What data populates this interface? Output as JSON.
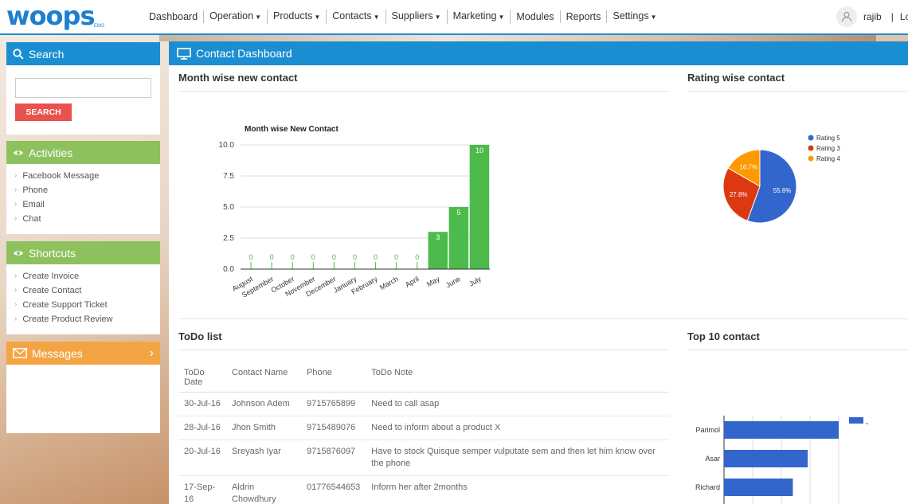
{
  "app": {
    "logo": "woops",
    "logo_sub": "EMS"
  },
  "nav": [
    {
      "label": "Dashboard",
      "caret": false
    },
    {
      "label": "Operation",
      "caret": true
    },
    {
      "label": "Products",
      "caret": true
    },
    {
      "label": "Contacts",
      "caret": true
    },
    {
      "label": "Suppliers",
      "caret": true
    },
    {
      "label": "Marketing",
      "caret": true
    },
    {
      "label": "Modules",
      "caret": false
    },
    {
      "label": "Reports",
      "caret": false
    },
    {
      "label": "Settings",
      "caret": true
    }
  ],
  "user": {
    "name": "rajib",
    "sep": "|",
    "logout": "Lo"
  },
  "sidebar": {
    "search": {
      "title": "Search",
      "placeholder": "",
      "button": "SEARCH"
    },
    "activities": {
      "title": "Activities",
      "items": [
        "Facebook Message",
        "Phone",
        "Email",
        "Chat"
      ]
    },
    "shortcuts": {
      "title": "Shortcuts",
      "items": [
        "Create Invoice",
        "Create Contact",
        "Create Support Ticket",
        "Create Product Review"
      ]
    },
    "messages": {
      "title": "Messages",
      "chevron": "›"
    }
  },
  "main": {
    "title": "Contact Dashboard",
    "month_section": "Month wise new contact",
    "rating_section": "Rating wise contact",
    "todo_section": "ToDo list",
    "top10_section": "Top 10 contact"
  },
  "todo": {
    "headers": [
      "ToDo Date",
      "Contact Name",
      "Phone",
      "ToDo Note"
    ],
    "rows": [
      [
        "30-Jul-16",
        "Johnson Adem",
        "9715765899",
        "Need to call asap"
      ],
      [
        "28-Jul-16",
        "Jhon Smith",
        "9715489076",
        "Need to inform about a product X"
      ],
      [
        "20-Jul-16",
        "Sreyash Iyar",
        "9715876097",
        "Have to stock Quisque semper vulputate sem and then let him know over the phone"
      ],
      [
        "17-Sep-16",
        "Aldrin Chowdhury",
        "01776544653",
        "Inform her after 2months"
      ]
    ]
  },
  "chart_data": [
    {
      "type": "bar",
      "title": "Month wise New Contact",
      "categories": [
        "August",
        "September",
        "October",
        "November",
        "December",
        "January",
        "February",
        "March",
        "April",
        "May",
        "June",
        "July"
      ],
      "values": [
        0,
        0,
        0,
        0,
        0,
        0,
        0,
        0,
        0,
        3,
        5,
        10
      ],
      "yticks": [
        "0.0",
        "2.5",
        "5.0",
        "7.5",
        "10.0"
      ],
      "ylim": [
        0,
        10
      ],
      "color": "#4cbb4c",
      "grid": true
    },
    {
      "type": "pie",
      "slices": [
        {
          "label": "Rating 5",
          "value": 55.6,
          "text": "55.6%",
          "color": "#3366cc"
        },
        {
          "label": "Rating 3",
          "value": 27.8,
          "text": "27.8%",
          "color": "#dc3912"
        },
        {
          "label": "Rating 4",
          "value": 16.7,
          "text": "16.7%",
          "color": "#ff9900"
        }
      ],
      "legend_position": "right"
    },
    {
      "type": "bar",
      "orientation": "horizontal",
      "categories": [
        "Parimol",
        "Asar",
        "Richard"
      ],
      "values": [
        100,
        73,
        60
      ],
      "color": "#3366cc",
      "legend_position": "top-right",
      "grid": true
    }
  ]
}
